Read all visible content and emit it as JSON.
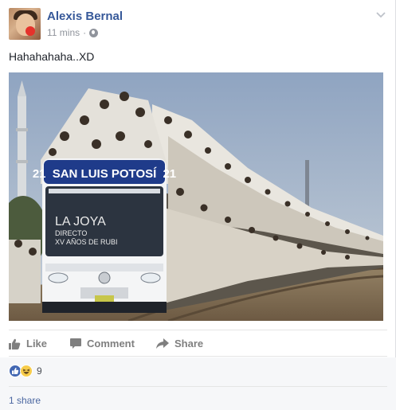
{
  "post": {
    "author": "Alexis Bernal",
    "time": "11 mins",
    "separator": "·",
    "text": "Hahahahaha..XD"
  },
  "photo": {
    "bus_route_number": "21",
    "bus_destination": "SAN LUIS POTOSÍ",
    "bus_route_number_right": "21",
    "bus_sign_line1": "LA JOYA",
    "bus_sign_line2": "DIRECTO",
    "bus_sign_line3": "XV AÑOS DE RUBI"
  },
  "actions": {
    "like": "Like",
    "comment": "Comment",
    "share": "Share"
  },
  "reactions": {
    "count": "9",
    "types": [
      "like-icon",
      "haha-icon"
    ],
    "shares": "1 share"
  },
  "colors": {
    "author": "#365899",
    "meta": "#90949c",
    "action": "#7f7f7f",
    "like_blue": "#4267b2",
    "haha_yellow": "#f7cc4b",
    "footer_bg": "#f6f7f9"
  }
}
